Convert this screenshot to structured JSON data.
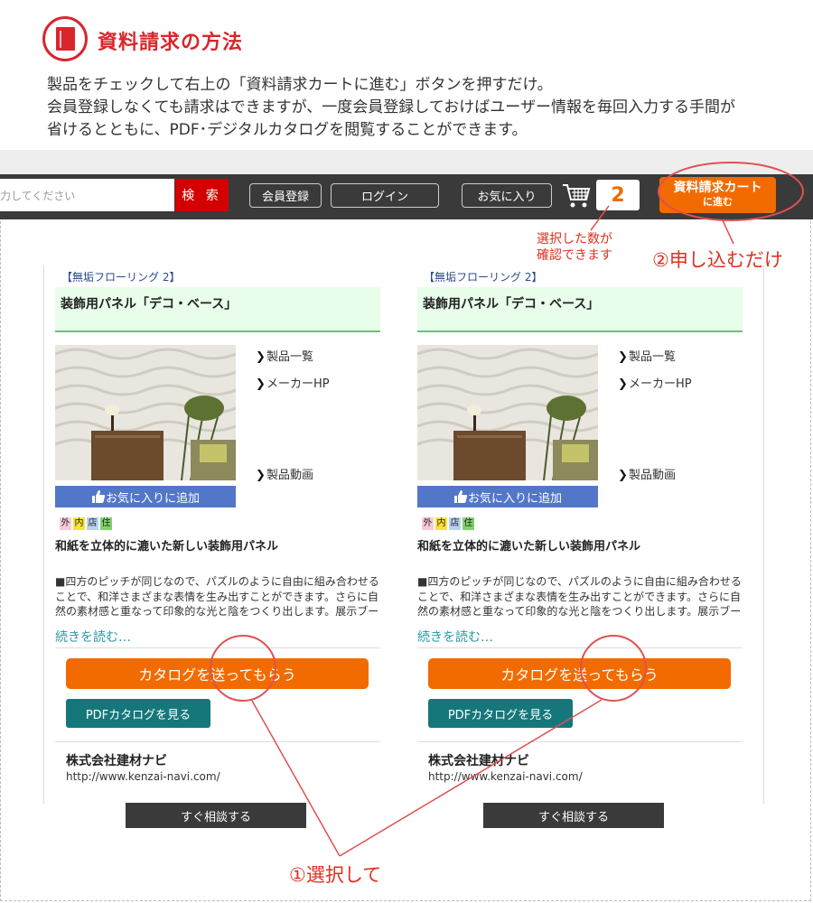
{
  "intro": {
    "title": "資料請求の方法",
    "line1": "製品をチェックして右上の「資料請求カートに進む」ボタンを押すだけ。",
    "line2": "会員登録しなくても請求はできますが、一度会員登録しておけばユーザー情報を毎回入力する手間が",
    "line3": "省けるとともに、PDF･デジタルカタログを閲覧することができます。"
  },
  "navbar": {
    "search_placeholder": "入力してください",
    "search_button": "検 索",
    "register": "会員登録",
    "login": "ログイン",
    "favorites": "お気に入り",
    "cart_count": "2",
    "cart_button_line1": "資料請求カート",
    "cart_button_line2": "に進む"
  },
  "annotations": {
    "count_note_line1": "選択した数が",
    "count_note_line2": "確認できます",
    "step2": "②申し込むだけ",
    "step1": "①選択して"
  },
  "cards": [
    {
      "category": "【無垢フローリング 2】",
      "title": "装飾用パネル「デコ・ベース」",
      "link_products": "製品一覧",
      "link_maker": "メーカーHP",
      "link_video": "製品動画",
      "favorite": "お気に入りに追加",
      "badges": [
        "外",
        "内",
        "店",
        "住"
      ],
      "subtitle": "和紙を立体的に漉いた新しい装飾用パネル",
      "description": "■四方のピッチが同じなので、パズルのように自由に組み合わせることで、和洋さまざまな表情を生み出すことができます。さらに自然の素材感と重なって印象的な光と陰をつくり出します。展示ブース",
      "read_more": "続きを読む…",
      "catalog_button": "カタログを送ってもらう",
      "pdf_button": "PDFカタログを見る",
      "company": "株式会社建材ナビ",
      "url": "http://www.kenzai-navi.com/",
      "consult": "すぐ相談する"
    },
    {
      "category": "【無垢フローリング 2】",
      "title": "装飾用パネル「デコ・ベース」",
      "link_products": "製品一覧",
      "link_maker": "メーカーHP",
      "link_video": "製品動画",
      "favorite": "お気に入りに追加",
      "badges": [
        "外",
        "内",
        "店",
        "住"
      ],
      "subtitle": "和紙を立体的に漉いた新しい装飾用パネル",
      "description": "■四方のピッチが同じなので、パズルのように自由に組み合わせることで、和洋さまざまな表情を生み出すことができます。さらに自然の素材感と重なって印象的な光と陰をつくり出します。展示ブース",
      "read_more": "続きを読む…",
      "catalog_button": "カタログを送ってもらう",
      "pdf_button": "PDFカタログを見る",
      "company": "株式会社建材ナビ",
      "url": "http://www.kenzai-navi.com/",
      "consult": "すぐ相談する"
    }
  ],
  "colors": {
    "accent_red": "#d9262c",
    "orange": "#f26b00",
    "teal": "#16777b",
    "nav_dark": "#3a3a3a",
    "fav_blue": "#5277c9",
    "badge_colors": [
      "#f7c9d9",
      "#f9e23b",
      "#b9d2f3",
      "#7fd36a"
    ]
  },
  "icons": [
    "book-icon",
    "cart-icon",
    "chevron-right-icon",
    "thumbs-up-icon"
  ]
}
